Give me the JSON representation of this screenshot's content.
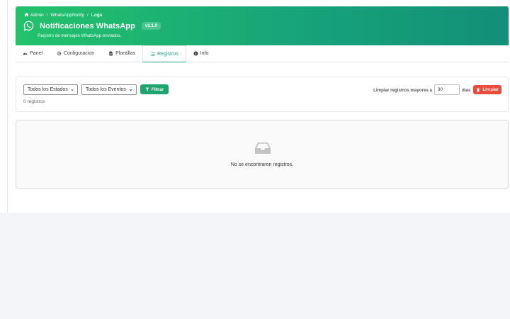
{
  "header": {
    "breadcrumb": [
      "Admin",
      "WhatsAppNotify",
      "Logs"
    ],
    "title": "Notificaciones WhatsApp",
    "version": "v1.1.0",
    "subtitle": "Registro de mensajes WhatsApp enviados."
  },
  "tabs": [
    {
      "label": "Panel",
      "icon": "dashboard-icon",
      "active": false
    },
    {
      "label": "Configuracion",
      "icon": "gear-icon",
      "active": false
    },
    {
      "label": "Plantillas",
      "icon": "file-icon",
      "active": false
    },
    {
      "label": "Registros",
      "icon": "list-icon",
      "active": true
    },
    {
      "label": "Info",
      "icon": "info-icon",
      "active": false
    }
  ],
  "filters": {
    "status_selected": "Todos los Estados",
    "event_selected": "Todos los Eventos",
    "filter_label": "Filtrar",
    "purge_label": "Limpiar registros mayores a",
    "days_value": "30",
    "days_unit": "dias",
    "clear_label": "Limpiar",
    "count_text": "0 registros"
  },
  "empty": {
    "message": "No se encontraron registros."
  },
  "colors": {
    "brand": "#1ea56f",
    "danger": "#e74c3c",
    "header_start": "#23c26b",
    "header_end": "#138f78"
  }
}
